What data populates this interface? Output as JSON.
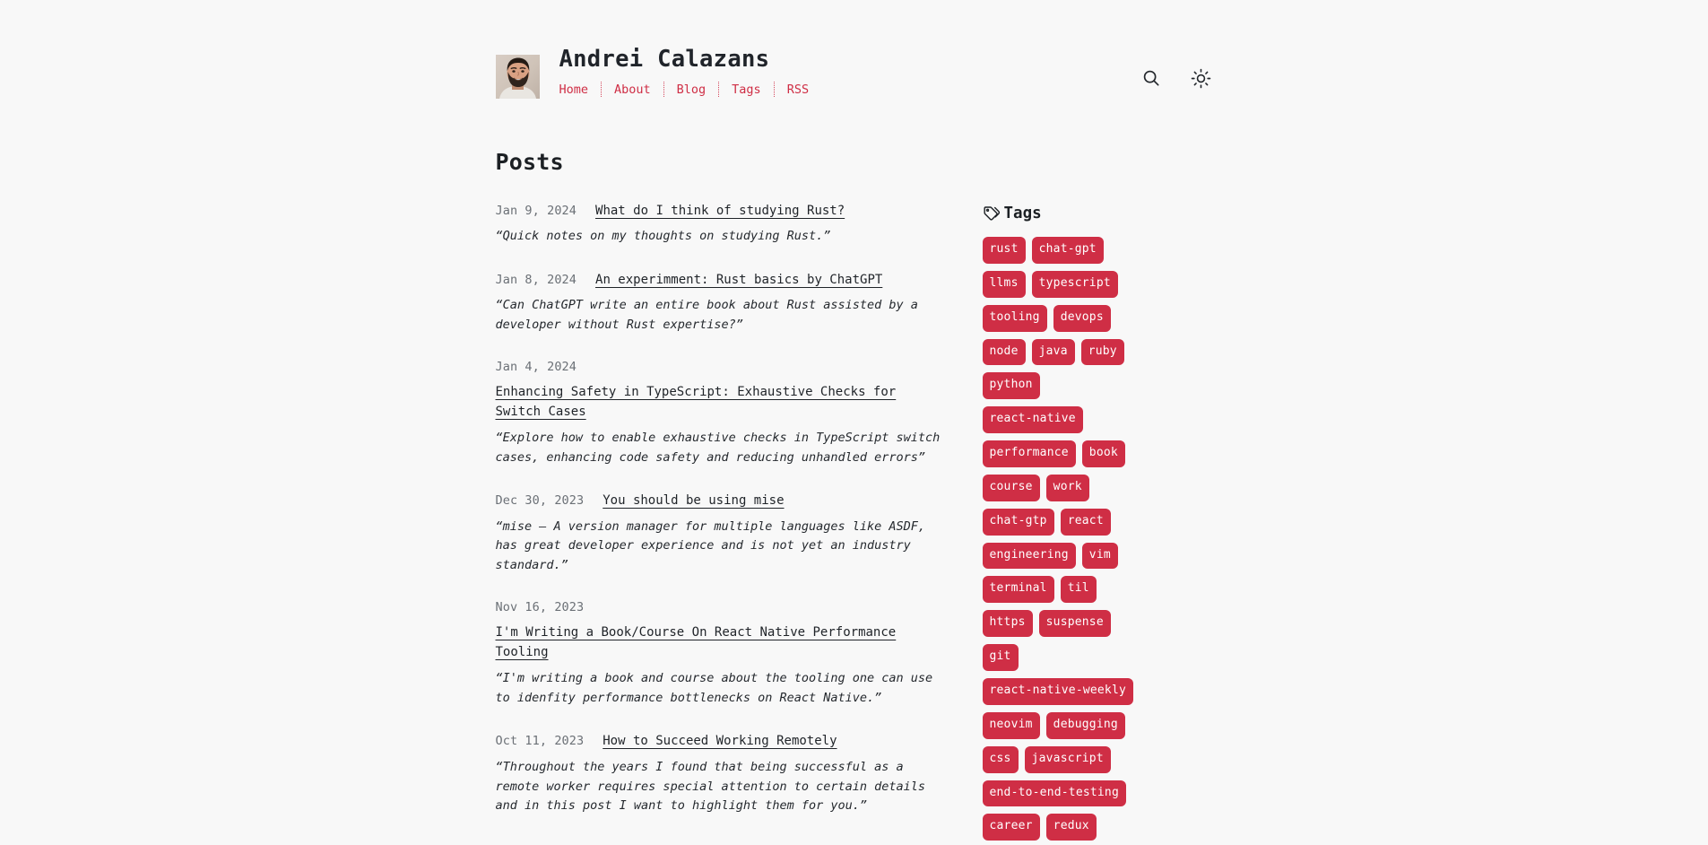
{
  "site": {
    "background_color": "#f8f8f8",
    "accent_color": "#cf2e45",
    "title": "Andrei Calazans",
    "avatar_alt": "avatar"
  },
  "nav": {
    "items": [
      {
        "label": "Home"
      },
      {
        "label": "About"
      },
      {
        "label": "Blog"
      },
      {
        "label": "Tags"
      },
      {
        "label": "RSS"
      }
    ]
  },
  "header_actions": {
    "search": {
      "icon": "search-icon",
      "label": "Search"
    },
    "theme": {
      "icon": "sun-icon",
      "label": "Toggle light mode"
    }
  },
  "main": {
    "page_title": "Posts",
    "posts": [
      {
        "date": "Jan 9, 2024",
        "title": "What do I think of studying Rust?",
        "description": "“Quick notes on my thoughts on studying Rust.”",
        "stacked": false
      },
      {
        "date": "Jan 8, 2024",
        "title": "An experimment: Rust basics by ChatGPT",
        "description": "“Can ChatGPT write an entire book about Rust assisted by a developer without Rust expertise?”",
        "stacked": false
      },
      {
        "date": "Jan 4, 2024",
        "title": "Enhancing Safety in TypeScript: Exhaustive Checks for Switch Cases",
        "description": "“Explore how to enable exhaustive checks in TypeScript switch cases, enhancing code safety and reducing unhandled errors”",
        "stacked": true
      },
      {
        "date": "Dec 30, 2023",
        "title": "You should be using mise",
        "description": "“mise — A version manager for multiple languages like ASDF, has great developer experience and is not yet an industry standard.”",
        "stacked": false
      },
      {
        "date": "Nov 16, 2023",
        "title": "I'm Writing a Book/Course On React Native Performance Tooling",
        "description": "“I'm writing a book and course about the tooling one can use to idenfity performance bottlenecks on React Native.”",
        "stacked": true
      },
      {
        "date": "Oct 11, 2023",
        "title": "How to Succeed Working Remotely",
        "description": "“Throughout the years I found that being successful as a remote worker requires special attention to certain details and in this post I want to highlight them for you.”",
        "stacked": false
      }
    ]
  },
  "sidebar": {
    "tags_heading": "Tags",
    "tags_icon": "tags-icon",
    "tags": [
      "rust",
      "chat-gpt",
      "llms",
      "typescript",
      "tooling",
      "devops",
      "node",
      "java",
      "ruby",
      "python",
      "react-native",
      "performance",
      "book",
      "course",
      "work",
      "chat-gtp",
      "react",
      "engineering",
      "vim",
      "terminal",
      "til",
      "https",
      "suspense",
      "git",
      "react-native-weekly",
      "neovim",
      "debugging",
      "css",
      "javascript",
      "end-to-end-testing",
      "career",
      "redux"
    ]
  }
}
